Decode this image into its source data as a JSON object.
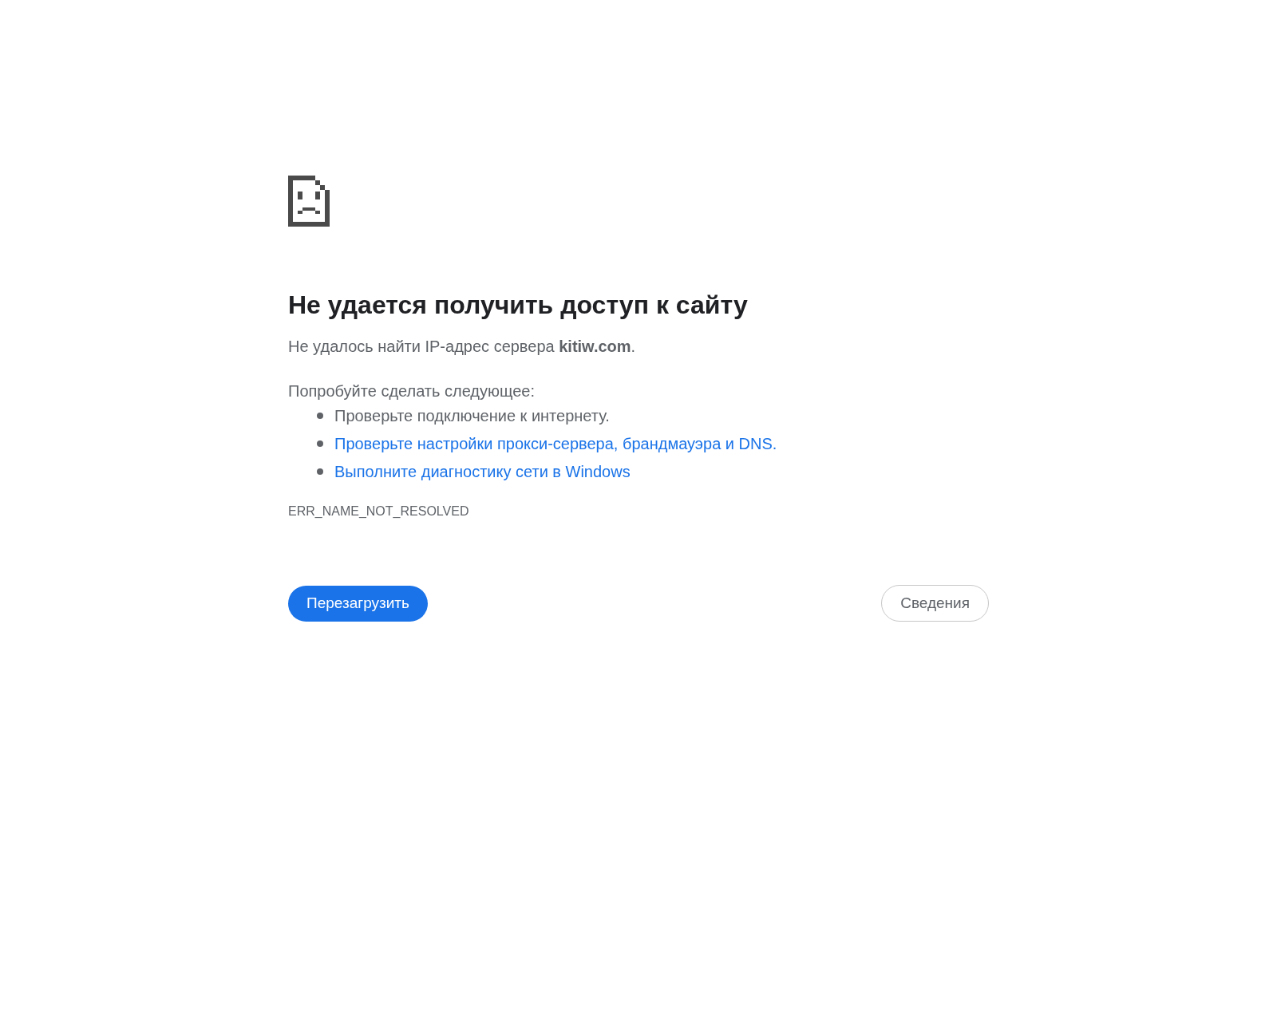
{
  "heading": "Не удается получить доступ к сайту",
  "message": "Не удалось найти IP-адрес сервера **kitiw.com**.",
  "suggestions_title": "Попробуйте сделать следующее:",
  "suggestions": [
    {
      "kind": "text",
      "text": "Проверьте подключение к интернету."
    },
    {
      "kind": "link",
      "text": "Проверьте настройки прокси-сервера, брандмауэра и DNS."
    },
    {
      "kind": "link",
      "text": "Выполните диагностику сети в Windows"
    }
  ],
  "error_code": "ERR_NAME_NOT_RESOLVED",
  "buttons": [
    {
      "kind": "primary",
      "label": "Перезагрузить"
    },
    {
      "kind": "secondary",
      "label": "Сведения"
    }
  ]
}
